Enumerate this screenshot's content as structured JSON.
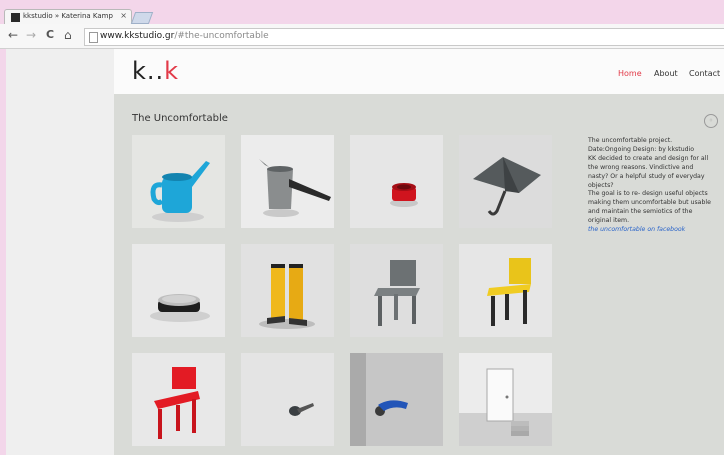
{
  "browser": {
    "tab_title": "kkstudio » Katerina Kamp",
    "tab_close": "×",
    "url_domain": "www.kkstudio.gr",
    "url_path": "/#the-uncomfortable",
    "nav": {
      "back": "←",
      "forward": "→",
      "reload": "C",
      "home": "⌂"
    }
  },
  "site": {
    "logo_left": "k..",
    "logo_right": "k",
    "menu": [
      {
        "label": "Home",
        "active": true
      },
      {
        "label": "About",
        "active": false
      },
      {
        "label": "Contact",
        "active": false
      }
    ],
    "section_title": "The Uncomfortable",
    "close_glyph": "◦",
    "description_lines": [
      "The uncomfortable project.",
      "Date:Ongoing Design: by kkstudio",
      "KK decided to create and design for all",
      "the wrong reasons. Vindictive and",
      "nasty? Or a helpful study of everyday",
      "objects?",
      "The goal is to re- design useful objects",
      "making them uncomfortable but usable",
      "and maintain the semiotics of the",
      "original item."
    ],
    "facebook_link": "the uncomfortable on facebook",
    "gallery": [
      {
        "name": "watering-can"
      },
      {
        "name": "coffee-pot"
      },
      {
        "name": "red-cup"
      },
      {
        "name": "umbrella"
      },
      {
        "name": "pill-box"
      },
      {
        "name": "yellow-boots"
      },
      {
        "name": "grey-chair"
      },
      {
        "name": "yellow-chair"
      },
      {
        "name": "red-chair"
      },
      {
        "name": "key"
      },
      {
        "name": "door-handle"
      },
      {
        "name": "door-stairs"
      }
    ]
  },
  "colors": {
    "accent": "#e23a48",
    "link": "#2a64c9",
    "panel": "#d9dbd7"
  }
}
